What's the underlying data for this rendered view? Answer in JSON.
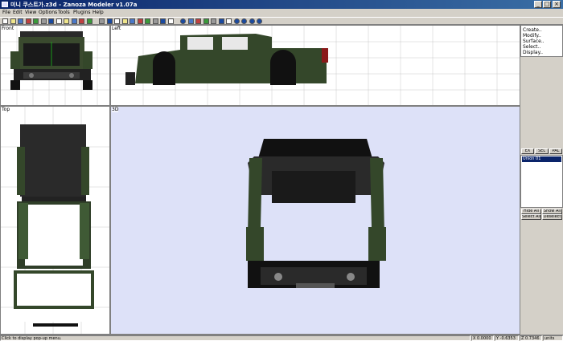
{
  "window": {
    "title": "미니 쿠스트가.z3d - Zanoza Modeler v1.07a",
    "min_glyph": "_",
    "max_glyph": "□",
    "close_glyph": "×"
  },
  "menu": [
    "File",
    "Edit",
    "View",
    "Options",
    "Tools",
    "Plugins",
    "Help"
  ],
  "toolbar_icons": [
    "new-icon",
    "open-icon",
    "save-icon",
    "cut-icon",
    "copy-icon",
    "paste-icon",
    "undo-icon",
    "redo-icon",
    "h-icon",
    "v-icon",
    "d-icon",
    "render-icon",
    "select-icon",
    "move-icon",
    "rotate-icon",
    "scale-icon",
    "paint-icon",
    "zoom-icon",
    "pan-icon",
    "fit-icon",
    "light-icon",
    "tex-icon",
    "sphere-icon",
    "vertex-icon",
    "edge-icon",
    "face-icon",
    "edit-icon",
    "z-icon",
    "cube-icon",
    "cylinder-icon",
    "cone-icon",
    "torus-icon",
    "lathe-icon"
  ],
  "viewports": {
    "front": "Front",
    "left": "Left",
    "top": "Top",
    "persp": "3D"
  },
  "side_panel": {
    "commands": [
      "Create..",
      "Modify..",
      "Surface..",
      "Select..",
      "Display.."
    ],
    "tabs": [
      "EX",
      "SEL",
      "PAL"
    ],
    "objects": [
      "Union 01"
    ],
    "buttons": [
      "Hide All",
      "Show All",
      "Select All",
      "Deselect"
    ]
  },
  "status": {
    "message": "Click to display pop-up menu.",
    "x_label": "X",
    "x_value": "0.0000",
    "y_label": "Y",
    "y_value": "-0.6353",
    "z_label": "Z",
    "z_value": "0.7346",
    "units": "units"
  },
  "colors": {
    "titlebar": "#0a246a",
    "body_green": "#34472a",
    "persp_bg": "#dde1f8"
  }
}
